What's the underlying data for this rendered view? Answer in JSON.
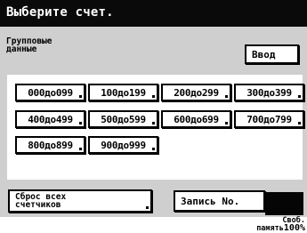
{
  "header": {
    "title": "Выберите счет."
  },
  "group": {
    "line1": "Групповые",
    "line2": "данные"
  },
  "enter_button": "Ввод",
  "ranges": [
    "000до099",
    "100до199",
    "200до299",
    "300до399",
    "400до499",
    "500до599",
    "600до699",
    "700до799",
    "800до899",
    "900до999"
  ],
  "reset": {
    "line1": "Сброс всех",
    "line2": "счетчиков"
  },
  "record_button": "Запись No.",
  "status": {
    "line1": "Своб.",
    "line2": "память",
    "percent": "100%"
  }
}
